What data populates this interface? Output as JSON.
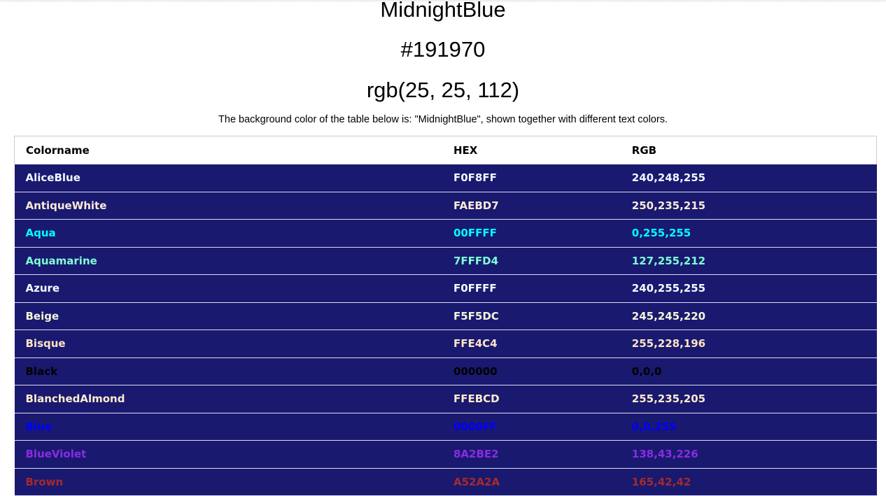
{
  "header": {
    "color_name": "MidnightBlue",
    "hex": "#191970",
    "rgb": "rgb(25, 25, 112)",
    "description": "The background color of the table below is: \"MidnightBlue\", shown together with different text colors."
  },
  "table": {
    "background": "#191970",
    "columns": [
      "Colorname",
      "HEX",
      "RGB"
    ],
    "rows": [
      {
        "name": "AliceBlue",
        "hex": "F0F8FF",
        "rgb": "240,248,255",
        "color": "#F0F8FF"
      },
      {
        "name": "AntiqueWhite",
        "hex": "FAEBD7",
        "rgb": "250,235,215",
        "color": "#FAEBD7"
      },
      {
        "name": "Aqua",
        "hex": "00FFFF",
        "rgb": "0,255,255",
        "color": "#00FFFF"
      },
      {
        "name": "Aquamarine",
        "hex": "7FFFD4",
        "rgb": "127,255,212",
        "color": "#7FFFD4"
      },
      {
        "name": "Azure",
        "hex": "F0FFFF",
        "rgb": "240,255,255",
        "color": "#F0FFFF"
      },
      {
        "name": "Beige",
        "hex": "F5F5DC",
        "rgb": "245,245,220",
        "color": "#F5F5DC"
      },
      {
        "name": "Bisque",
        "hex": "FFE4C4",
        "rgb": "255,228,196",
        "color": "#FFE4C4"
      },
      {
        "name": "Black",
        "hex": "000000",
        "rgb": "0,0,0",
        "color": "#000000"
      },
      {
        "name": "BlanchedAlmond",
        "hex": "FFEBCD",
        "rgb": "255,235,205",
        "color": "#FFEBCD"
      },
      {
        "name": "Blue",
        "hex": "0000FF",
        "rgb": "0,0,255",
        "color": "#0000FF"
      },
      {
        "name": "BlueViolet",
        "hex": "8A2BE2",
        "rgb": "138,43,226",
        "color": "#8A2BE2"
      },
      {
        "name": "Brown",
        "hex": "A52A2A",
        "rgb": "165,42,42",
        "color": "#A52A2A"
      }
    ]
  }
}
